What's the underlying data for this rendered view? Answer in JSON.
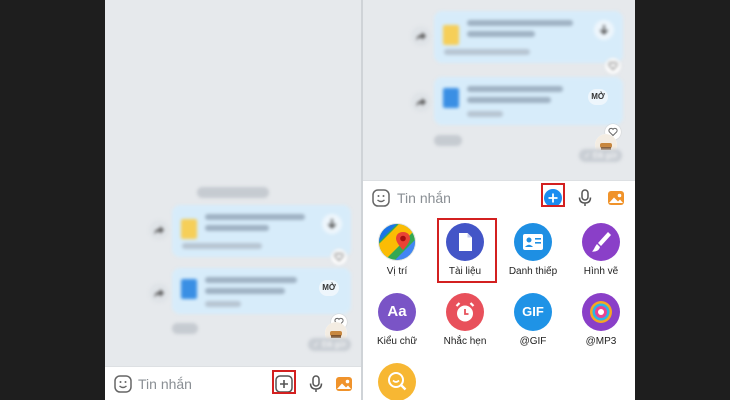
{
  "left_panel": {
    "date_separator": "",
    "message_2_action": "MỞ",
    "sent_status": "Đã gửi",
    "input_placeholder": "Tin nhắn"
  },
  "right_panel": {
    "message_2_action": "MỞ",
    "sent_status": "Đã gửi",
    "input_placeholder": "Tin nhắn",
    "apps": [
      {
        "label": "Vị trí",
        "icon": "map-location-icon"
      },
      {
        "label": "Tài liệu",
        "icon": "document-icon"
      },
      {
        "label": "Danh thiếp",
        "icon": "contact-card-icon"
      },
      {
        "label": "Hình vẽ",
        "icon": "paintbrush-icon"
      },
      {
        "label": "Kiểu chữ",
        "icon": "font-style-icon"
      },
      {
        "label": "Nhắc hẹn",
        "icon": "alarm-clock-icon"
      },
      {
        "label": "@GIF",
        "icon": "gif-icon"
      },
      {
        "label": "@MP3",
        "icon": "music-disc-icon"
      },
      {
        "label": "",
        "icon": "search-sticker-icon"
      }
    ],
    "gif_text": "GIF",
    "font_icon_text": "Aa"
  },
  "colors": {
    "accent_blue": "#1a8cf0",
    "highlight_red": "#d32020",
    "bubble_blue": "#d7ecfa"
  }
}
